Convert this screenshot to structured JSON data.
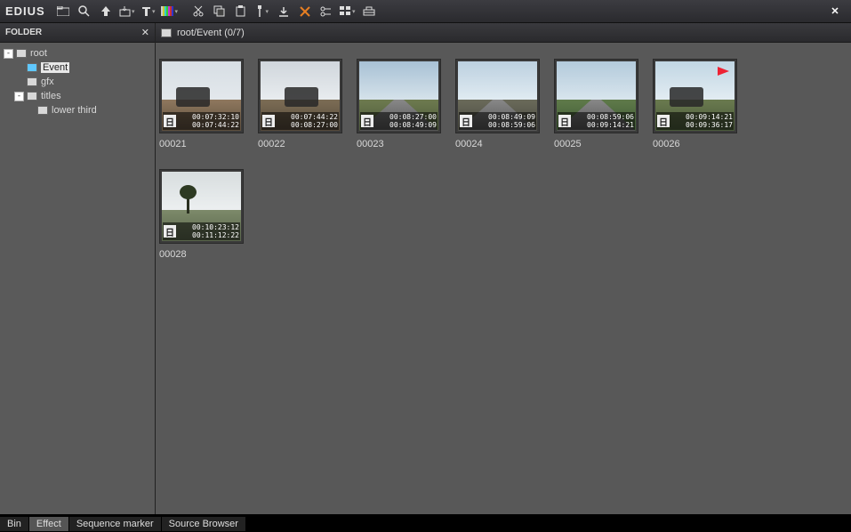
{
  "brand": "EDIUS",
  "folder_panel_title": "FOLDER",
  "tree": {
    "root": "root",
    "event": "Event",
    "gfx": "gfx",
    "titles": "titles",
    "lower_third": "lower third"
  },
  "breadcrumb": "root/Event (0/7)",
  "clips": [
    {
      "name": "00021",
      "in": "00:07:32:10",
      "out": "00:07:44:22"
    },
    {
      "name": "00022",
      "in": "00:07:44:22",
      "out": "00:08:27:00"
    },
    {
      "name": "00023",
      "in": "00:08:27:00",
      "out": "00:08:49:09"
    },
    {
      "name": "00024",
      "in": "00:08:49:09",
      "out": "00:08:59:06"
    },
    {
      "name": "00025",
      "in": "00:08:59:06",
      "out": "00:09:14:21"
    },
    {
      "name": "00026",
      "in": "00:09:14:21",
      "out": "00:09:36:17"
    },
    {
      "name": "00028",
      "in": "00:10:23:12",
      "out": "00:11:12:22"
    }
  ],
  "bottom_tabs": {
    "bin": "Bin",
    "effect": "Effect",
    "sequence_marker": "Sequence marker",
    "source_browser": "Source Browser"
  },
  "icons": {
    "audio_glyph": "日"
  }
}
